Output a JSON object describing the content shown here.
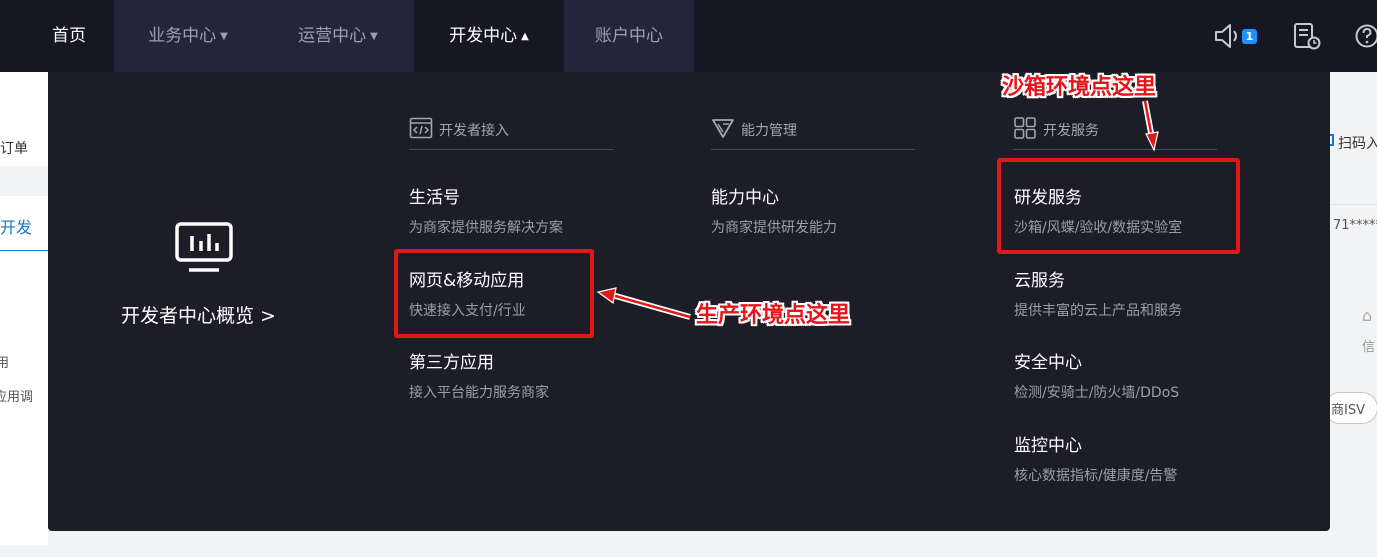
{
  "nav": {
    "home": "首页",
    "business_center": "业务中心",
    "operations_center": "运营中心",
    "developer_center": "开发中心",
    "account_center": "账户中心",
    "notification_count": "1"
  },
  "background": {
    "order_text": "订单",
    "dev_tab_text": "开发",
    "left_fragment_1": "用",
    "left_fragment_2": "应用调",
    "scan_text": "扫码入",
    "account_masked": "71*****",
    "info_text": "信",
    "isv_text": "商ISV"
  },
  "dropdown": {
    "overview_label": "开发者中心概览 >",
    "columns": [
      {
        "heading": "开发者接入",
        "icon": "code-window-icon",
        "entries": [
          {
            "title": "生活号",
            "desc": "为商家提供服务解决方案"
          },
          {
            "title": "网页&移动应用",
            "desc": "快速接入支付/行业"
          },
          {
            "title": "第三方应用",
            "desc": "接入平台能力服务商家"
          }
        ]
      },
      {
        "heading": "能力管理",
        "icon": "capability-triangle-icon",
        "entries": [
          {
            "title": "能力中心",
            "desc": "为商家提供研发能力"
          }
        ]
      },
      {
        "heading": "开发服务",
        "icon": "grid-icon",
        "entries": [
          {
            "title": "研发服务",
            "desc": "沙箱/风蝶/验收/数据实验室"
          },
          {
            "title": "云服务",
            "desc": "提供丰富的云上产品和服务"
          },
          {
            "title": "安全中心",
            "desc": "检测/安骑士/防火墙/DDoS"
          },
          {
            "title": "监控中心",
            "desc": "核心数据指标/健康度/告警"
          }
        ]
      }
    ]
  },
  "annotations": {
    "sandbox_callout": "沙箱环境点这里",
    "production_callout": "生产环境点这里",
    "color": "#e01818"
  },
  "colors": {
    "nav_bg": "#161722",
    "dropdown_bg": "#1d1d27",
    "badge": "#1e90ff"
  }
}
